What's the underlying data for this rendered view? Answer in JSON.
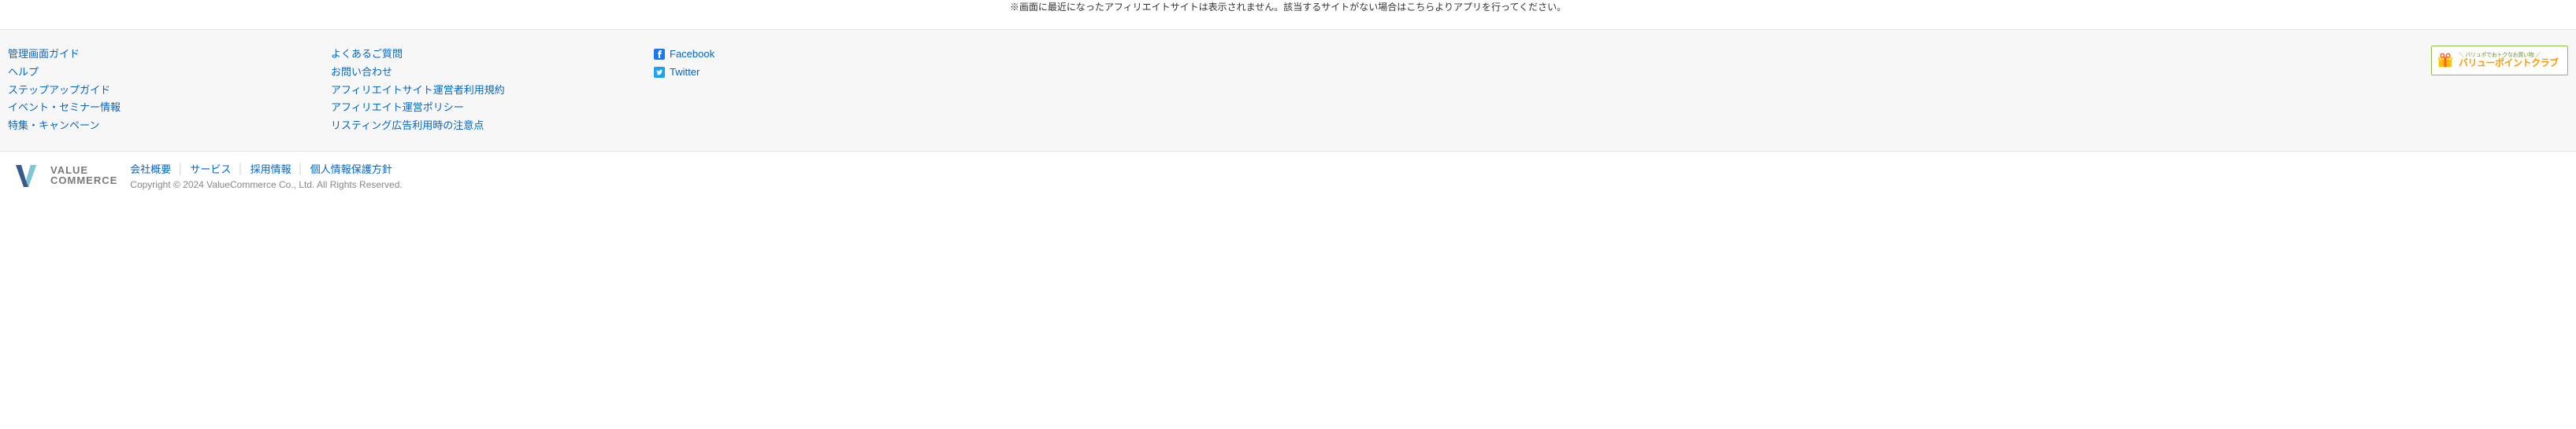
{
  "top_fragment": "※画面に最近になったアフィリエイトサイトは表示されません。該当するサイトがない場合はこちらよりアプリを行ってください。",
  "footer": {
    "col1": [
      "管理画面ガイド",
      "ヘルプ",
      "ステップアップガイド",
      "イベント・セミナー情報",
      "特集・キャンペーン"
    ],
    "col2": [
      "よくあるご質問",
      "お問い合わせ",
      "アフィリエイトサイト運営者利用規約",
      "アフィリエイト運営ポリシー",
      "リスティング広告利用時の注意点"
    ],
    "social": [
      {
        "name": "Facebook",
        "icon": "facebook-icon"
      },
      {
        "name": "Twitter",
        "icon": "twitter-icon"
      }
    ],
    "vpc": {
      "sub": "＼ バリュポでおトクなお買い物 ／",
      "main": "バリューポイントクラブ"
    }
  },
  "bottom": {
    "logo_line1": "VALUE",
    "logo_line2": "COMMERCE",
    "links": [
      "会社概要",
      "サービス",
      "採用情報",
      "個人情報保護方針"
    ],
    "copyright": "Copyright © 2024 ValueCommerce Co., Ltd. All Rights Reserved."
  }
}
